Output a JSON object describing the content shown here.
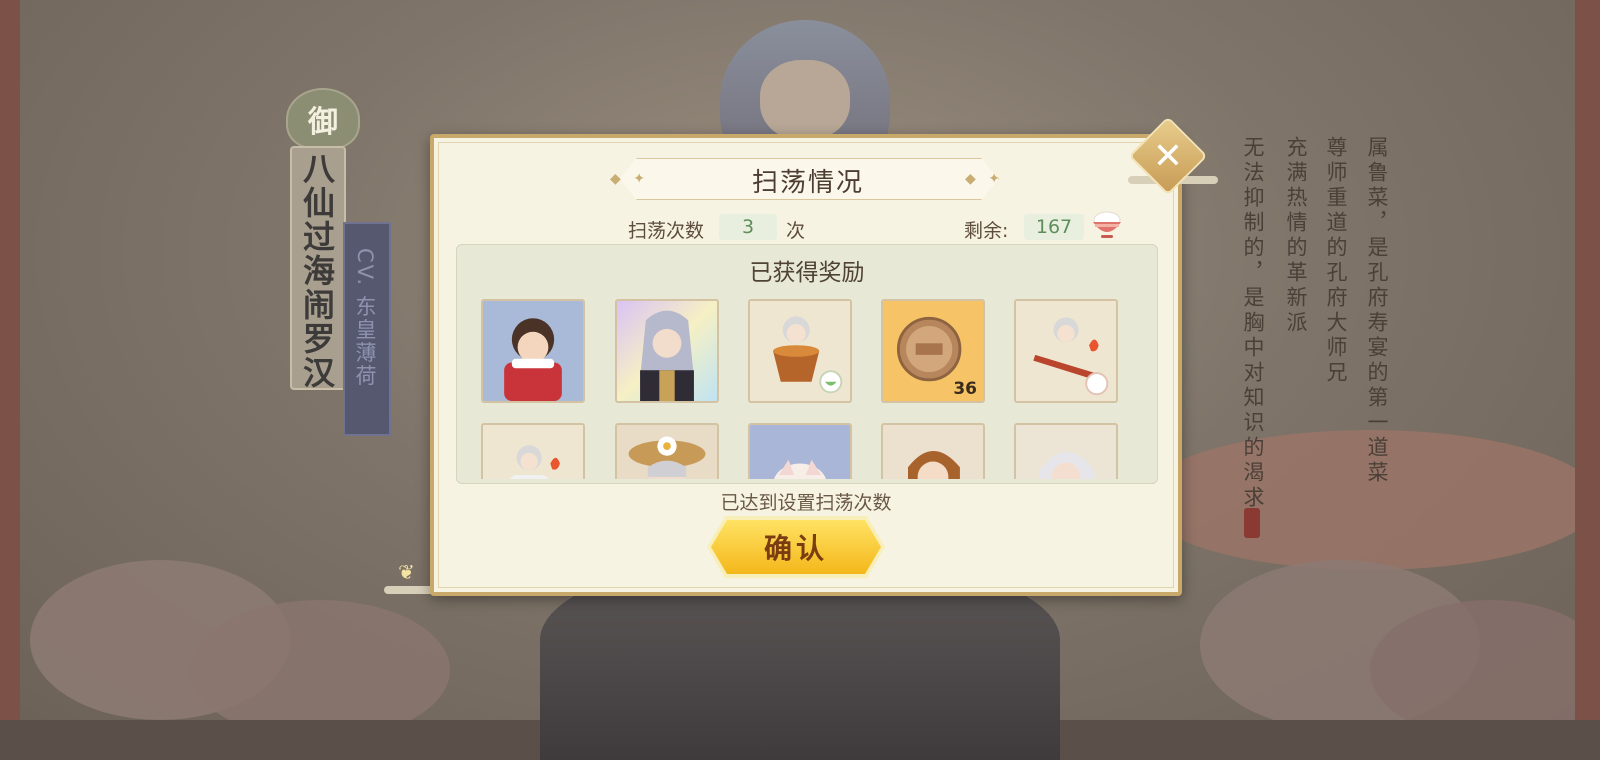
{
  "background": {
    "dish_badge": "御",
    "dish_name": "八仙过海闹罗汉",
    "cv": "CV. 东皇薄荷",
    "description_columns": [
      "属鲁菜，是孔府寿宴的第一道菜",
      "尊师重道的孔府大师兄",
      "充满热情的革新派",
      "无法抑制的，是胸中对知识的渴求"
    ]
  },
  "dialog": {
    "title": "扫荡情况",
    "sweep_label": "扫荡次数",
    "sweep_count": "3",
    "sweep_unit": "次",
    "remaining_label": "剩余:",
    "remaining_value": "167",
    "remaining_icon": "rice-bowl-icon",
    "rewards_title": "已获得奖励",
    "rewards": [
      {
        "name": "character-card-red-outfit",
        "count": ""
      },
      {
        "name": "character-card-silver-hair-rainbow",
        "count": ""
      },
      {
        "name": "chibi-cooking-pot-item",
        "count": ""
      },
      {
        "name": "bronze-coin-item",
        "count": "36"
      },
      {
        "name": "chibi-fire-broom-item",
        "count": ""
      },
      {
        "name": "chibi-fire-item",
        "count": ""
      },
      {
        "name": "character-card-straw-hat",
        "count": ""
      },
      {
        "name": "bun-item",
        "count": ""
      },
      {
        "name": "character-card-brown-hair",
        "count": ""
      },
      {
        "name": "character-card-white-hair",
        "count": ""
      }
    ],
    "status_text": "已达到设置扫荡次数",
    "confirm_label": "确认"
  },
  "colors": {
    "dialog_bg": "#f7f3e3",
    "dialog_border": "#c9a96a",
    "count_green": "#5f8d5c",
    "confirm_yellow": "#f4b71a"
  }
}
